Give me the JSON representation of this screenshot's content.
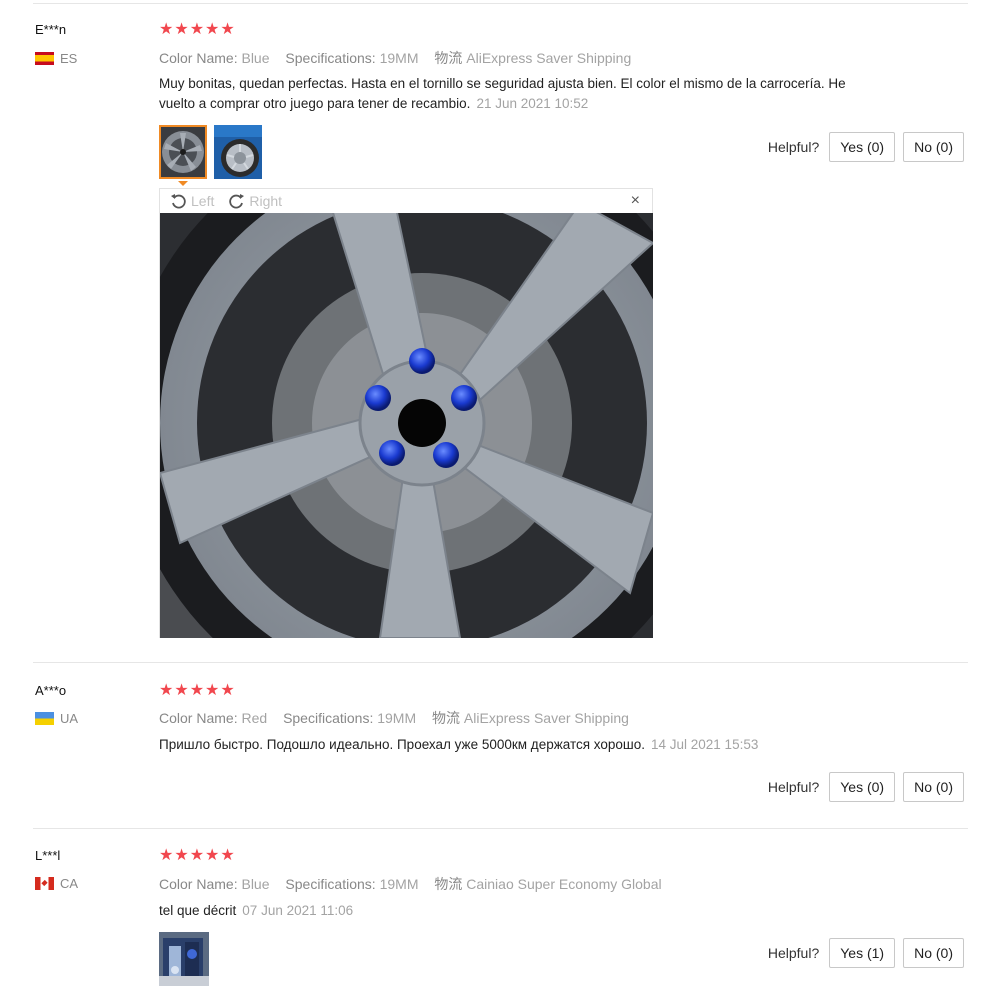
{
  "common": {
    "helpful_label": "Helpful?",
    "color_key": "Color Name:",
    "spec_key": "Specifications:",
    "ship_key": "物流"
  },
  "reviews": [
    {
      "user": "E***n",
      "country": "ES",
      "stars": "★★★★★",
      "color": "Blue",
      "spec": "19MM",
      "shipping": "AliExpress Saver Shipping",
      "comment": "Muy bonitas, quedan perfectas. Hasta en el tornillo se seguridad ajusta bien. El color el mismo de la carrocería. He vuelto a comprar otro juego para tener de recambio.",
      "date": "21 Jun 2021 10:52",
      "yes": "Yes (0)",
      "no": "No (0)"
    },
    {
      "user": "A***o",
      "country": "UA",
      "stars": "★★★★★",
      "color": "Red",
      "spec": "19MM",
      "shipping": "AliExpress Saver Shipping",
      "comment": "Пришло быстро. Подошло идеально. Проехал уже 5000км держатся хорошо.",
      "date": "14 Jul 2021 15:53",
      "yes": "Yes (0)",
      "no": "No (0)"
    },
    {
      "user": "L***l",
      "country": "CA",
      "stars": "★★★★★",
      "color": "Blue",
      "spec": "19MM",
      "shipping": "Cainiao Super Economy Global",
      "comment": "tel que décrit",
      "date": "07 Jun 2021 11:06",
      "yes": "Yes (1)",
      "no": "No (0)"
    }
  ],
  "viewer": {
    "left_label": "Left",
    "right_label": "Right",
    "close_glyph": "×"
  }
}
